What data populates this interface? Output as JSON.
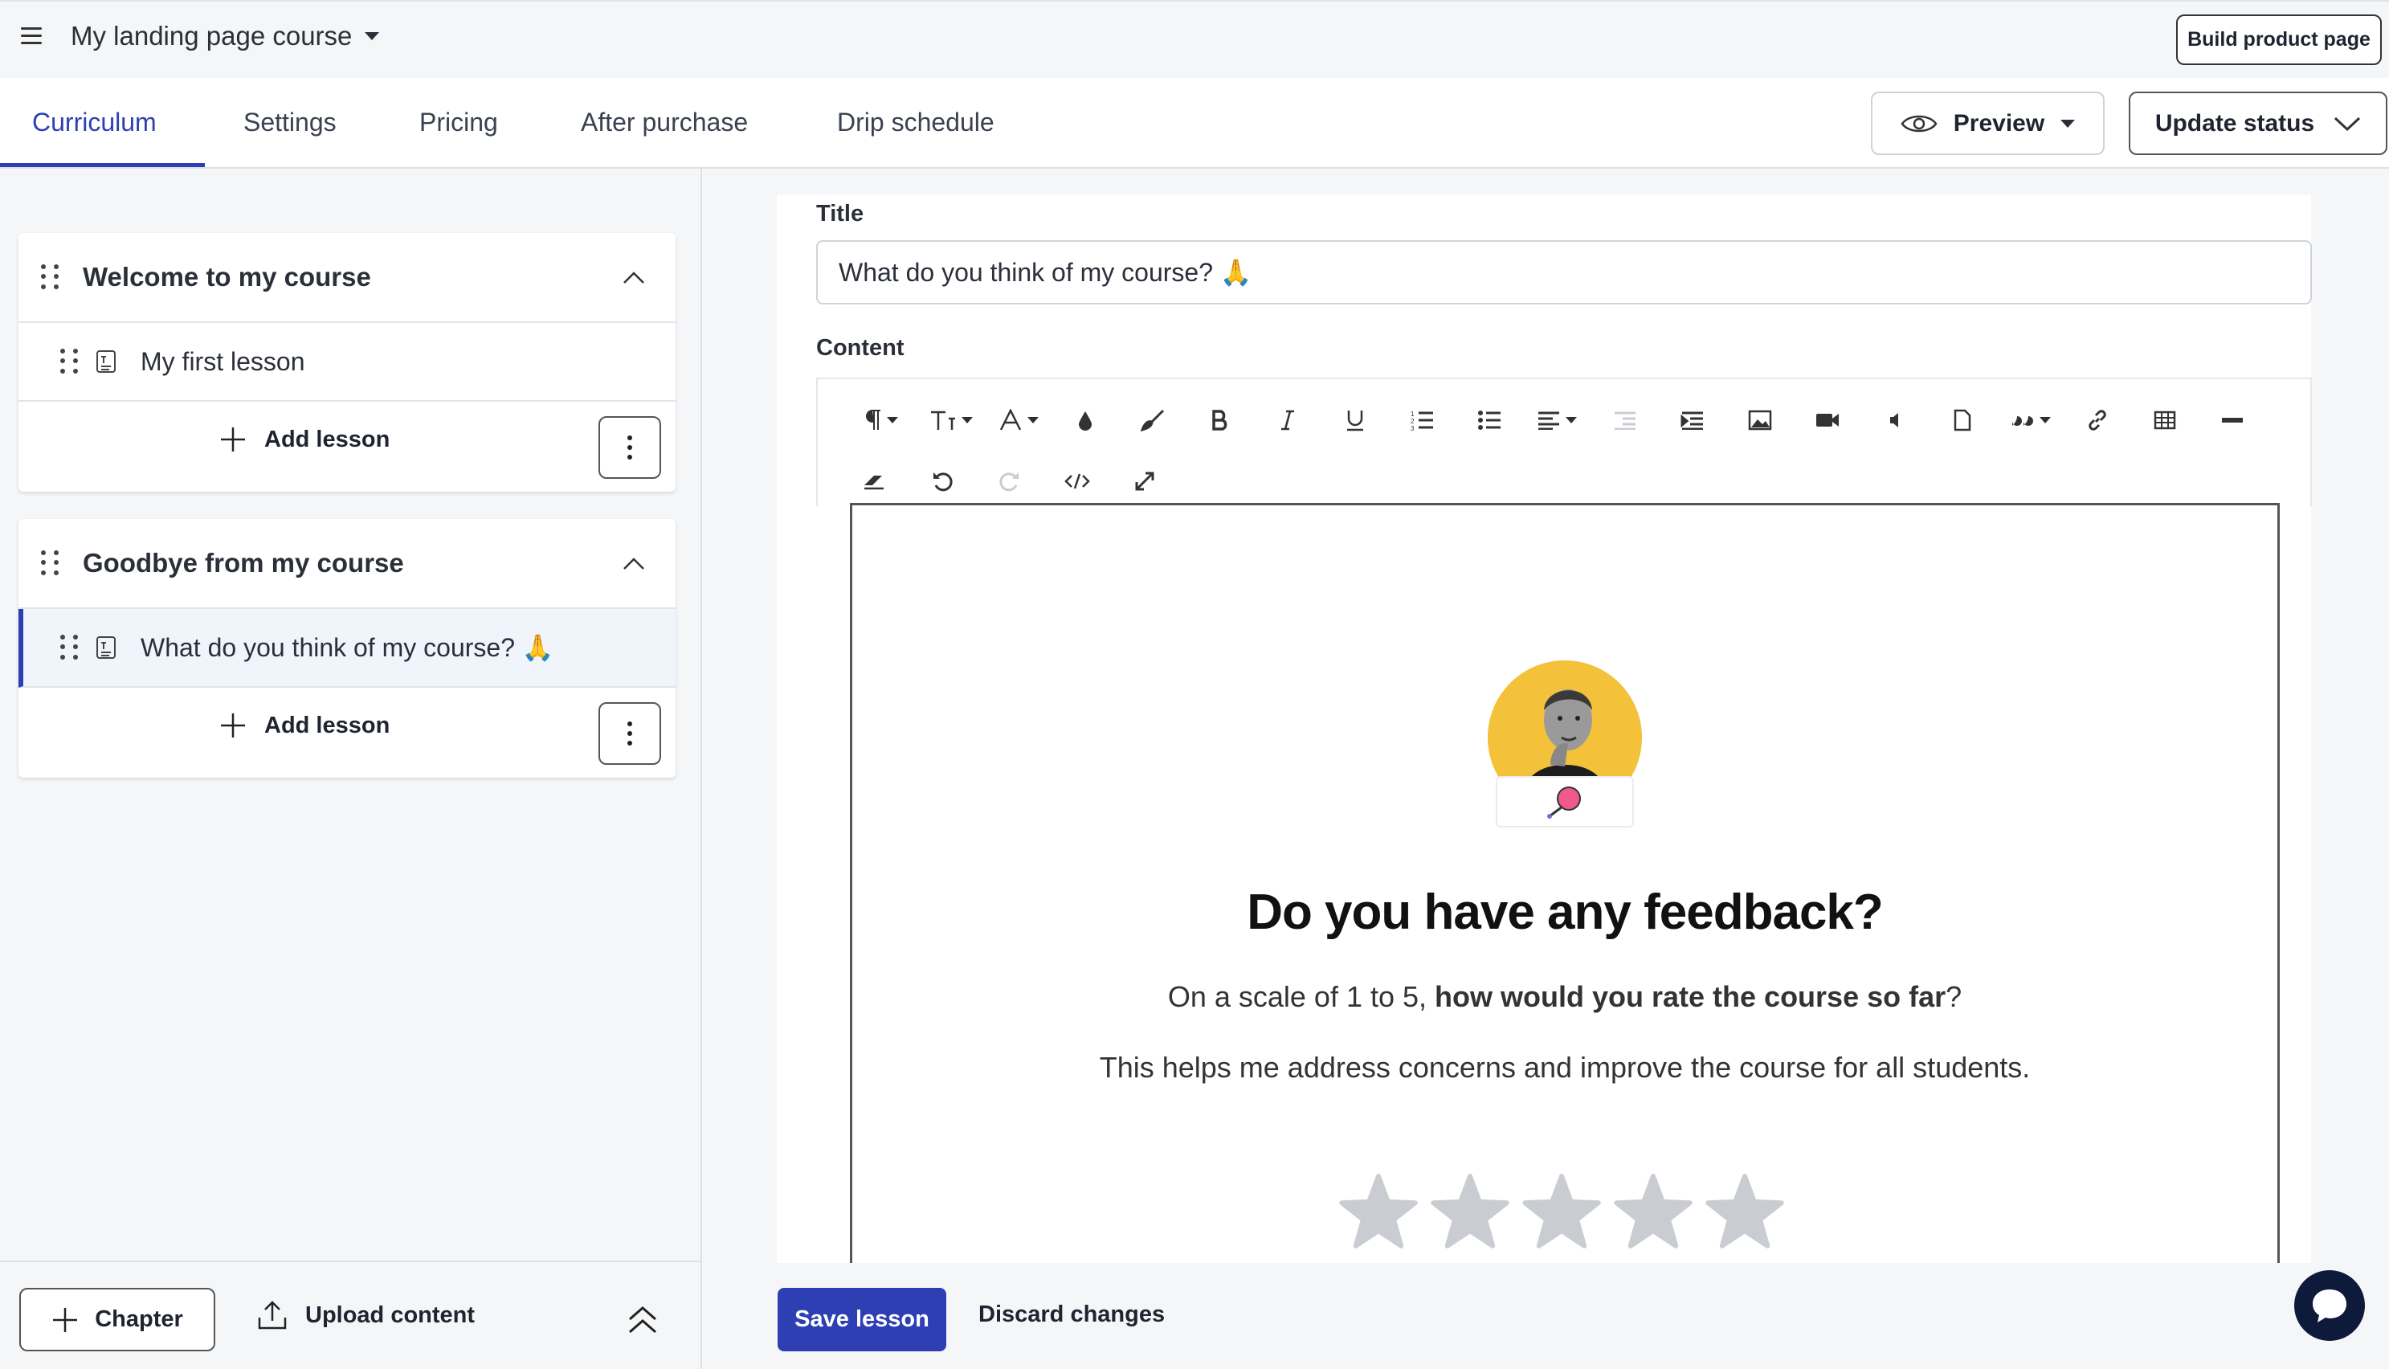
{
  "header": {
    "course_title": "My landing page course",
    "build_button": "Build product page"
  },
  "tabs": [
    {
      "label": "Curriculum",
      "active": true
    },
    {
      "label": "Settings"
    },
    {
      "label": "Pricing"
    },
    {
      "label": "After purchase"
    },
    {
      "label": "Drip schedule"
    }
  ],
  "actions": {
    "preview": "Preview",
    "update_status": "Update status"
  },
  "sidebar": {
    "chapters": [
      {
        "title": "Welcome to my course",
        "lessons": [
          {
            "title": "My first lesson",
            "active": false
          }
        ],
        "add_lesson": "Add lesson"
      },
      {
        "title": "Goodbye from my course",
        "lessons": [
          {
            "title": "What do you think of my course? 🙏",
            "active": true
          }
        ],
        "add_lesson": "Add lesson"
      }
    ],
    "footer": {
      "chapter_button": "Chapter",
      "upload_button": "Upload content"
    }
  },
  "editor": {
    "title_label": "Title",
    "title_value": "What do you think of my course? 🙏",
    "content_label": "Content",
    "content": {
      "heading": "Do you have any feedback?",
      "rate_prefix": "On a scale of 1 to 5, ",
      "rate_bold": "how would you rate the course so far",
      "rate_suffix": "?",
      "helps": "This helps me address concerns and improve the course for all students.",
      "star_count": 5,
      "star_color": "#c9ccd1"
    },
    "save_button": "Save lesson",
    "discard_button": "Discard changes"
  },
  "colors": {
    "accent": "#2d3fb3",
    "avatar_bg": "#f3c13a",
    "chat_bg": "#0d1a3a"
  }
}
